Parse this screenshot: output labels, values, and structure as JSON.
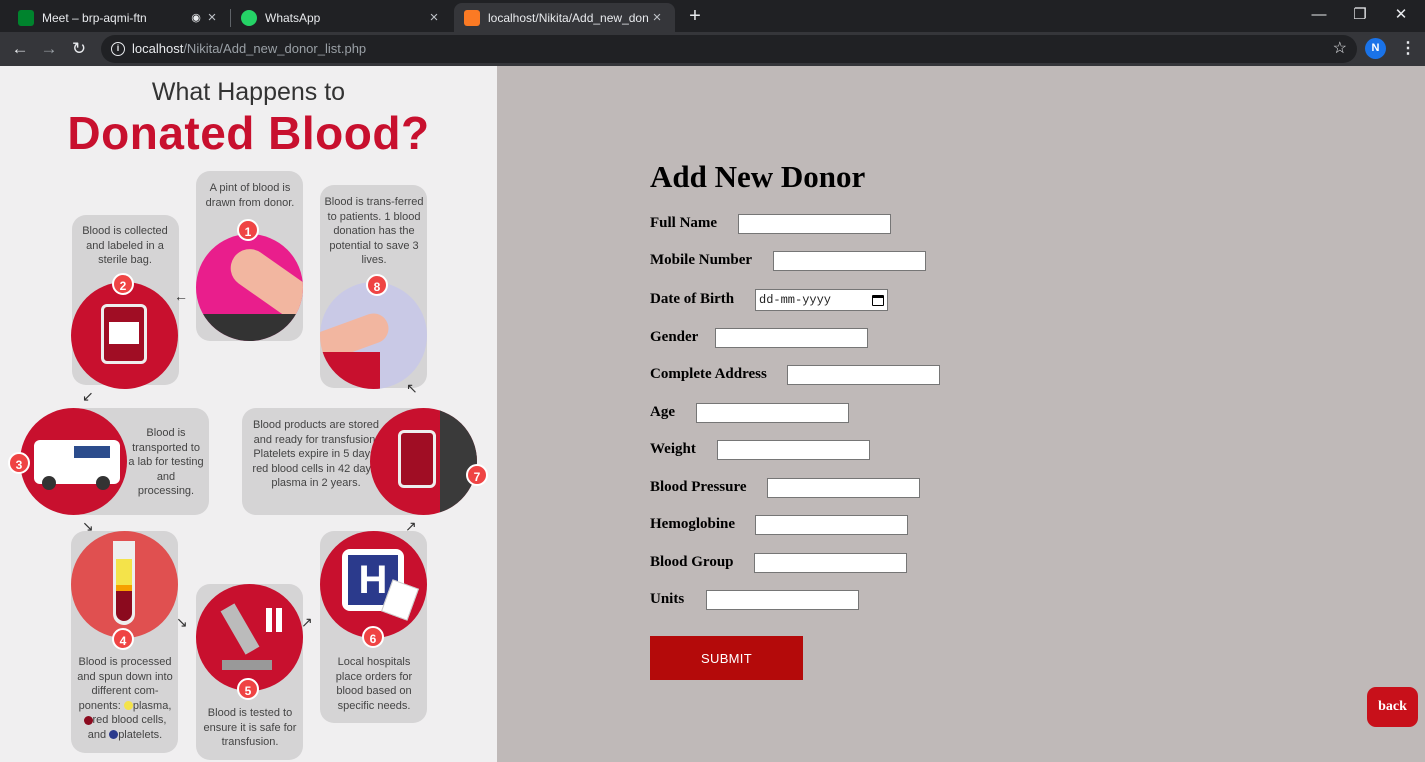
{
  "browser": {
    "tabs": [
      {
        "title": "Meet – brp-aqmi-ftn",
        "icon": "google-meet-icon",
        "recording": true
      },
      {
        "title": "WhatsApp",
        "icon": "whatsapp-icon"
      },
      {
        "title": "localhost/Nikita/Add_new_donor",
        "icon": "xampp-icon",
        "active": true
      }
    ],
    "url_host": "localhost",
    "url_path": "/Nikita/Add_new_donor_list.php",
    "profile_initial": "N"
  },
  "infographic": {
    "title_line1": "What Happens to",
    "title_line2": "Donated Blood?",
    "steps": [
      {
        "number": "1",
        "text": "A pint of blood is drawn from donor."
      },
      {
        "number": "2",
        "text": "Blood is collected and labeled in a sterile bag."
      },
      {
        "number": "3",
        "text": "Blood is transported to a lab for testing and processing."
      },
      {
        "number": "4",
        "text_before": "Blood is processed and spun down into different com-ponents:",
        "plasma": "plasma,",
        "red": "red blood cells,",
        "and": "and",
        "platelets": "platelets."
      },
      {
        "number": "5",
        "text": "Blood is tested to ensure it is safe for transfusion."
      },
      {
        "number": "6",
        "text": "Local hospitals place orders for blood based on specific needs."
      },
      {
        "number": "7",
        "text": "Blood products are stored and ready for transfusion. Platelets expire in 5 days, red blood cells in 42 days, plasma in 2 years."
      },
      {
        "number": "8",
        "text": "Blood is trans-ferred to patients. 1 blood donation has the potential to save 3 lives."
      }
    ]
  },
  "form": {
    "title": "Add New Donor",
    "fields": [
      {
        "label": "Full Name",
        "value": ""
      },
      {
        "label": "Mobile Number",
        "value": ""
      },
      {
        "label": "Date of Birth",
        "placeholder": "dd-mm-yyyy"
      },
      {
        "label": "Gender",
        "value": ""
      },
      {
        "label": "Complete Address",
        "value": ""
      },
      {
        "label": "Age",
        "value": ""
      },
      {
        "label": "Weight",
        "value": ""
      },
      {
        "label": "Blood Pressure",
        "value": ""
      },
      {
        "label": "Hemoglobine",
        "value": ""
      },
      {
        "label": "Blood Group",
        "value": ""
      },
      {
        "label": "Units",
        "value": ""
      }
    ],
    "submit_label": "SUBMIT",
    "back_label": "back"
  },
  "colors": {
    "accent_red": "#c8102e",
    "submit_bg": "#b40a0a",
    "page_bg": "#bfb9b8"
  }
}
